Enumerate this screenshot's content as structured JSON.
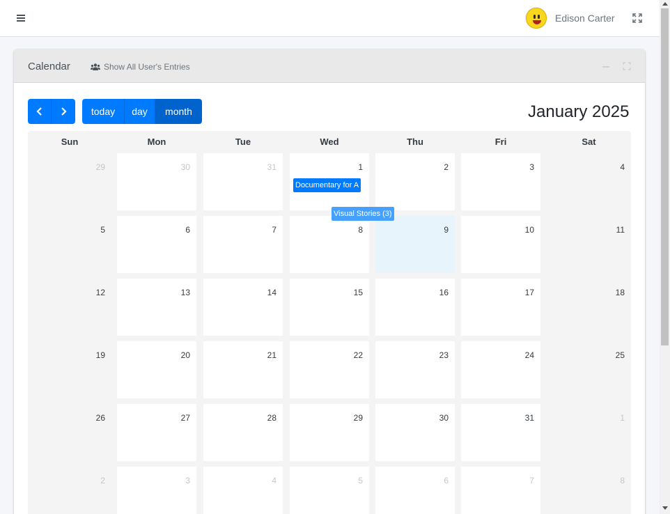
{
  "navbar": {
    "user_name": "Edison Carter"
  },
  "card": {
    "title": "Calendar",
    "show_all_label": "Show All User's Entries"
  },
  "toolbar": {
    "today_label": "today",
    "day_label": "day",
    "month_label": "month",
    "active_view": "month"
  },
  "calendar": {
    "title": "January 2025",
    "weekdays": [
      "Sun",
      "Mon",
      "Tue",
      "Wed",
      "Thu",
      "Fri",
      "Sat"
    ],
    "weeks": [
      [
        "29",
        "30",
        "31",
        "1",
        "2",
        "3",
        "4"
      ],
      [
        "5",
        "6",
        "7",
        "8",
        "9",
        "10",
        "11"
      ],
      [
        "12",
        "13",
        "14",
        "15",
        "16",
        "17",
        "18"
      ],
      [
        "19",
        "20",
        "21",
        "22",
        "23",
        "24",
        "25"
      ],
      [
        "26",
        "27",
        "28",
        "29",
        "30",
        "31",
        "1"
      ],
      [
        "2",
        "3",
        "4",
        "5",
        "6",
        "7",
        "8"
      ]
    ],
    "today": "9",
    "events": [
      {
        "label": "Documentary for A",
        "date": "1"
      },
      {
        "label": "Visual Stories (3)",
        "date": "8"
      }
    ]
  },
  "colors": {
    "primary": "#007bff",
    "today_bg": "#e8f4fb",
    "event_more": "#46a0ff"
  }
}
